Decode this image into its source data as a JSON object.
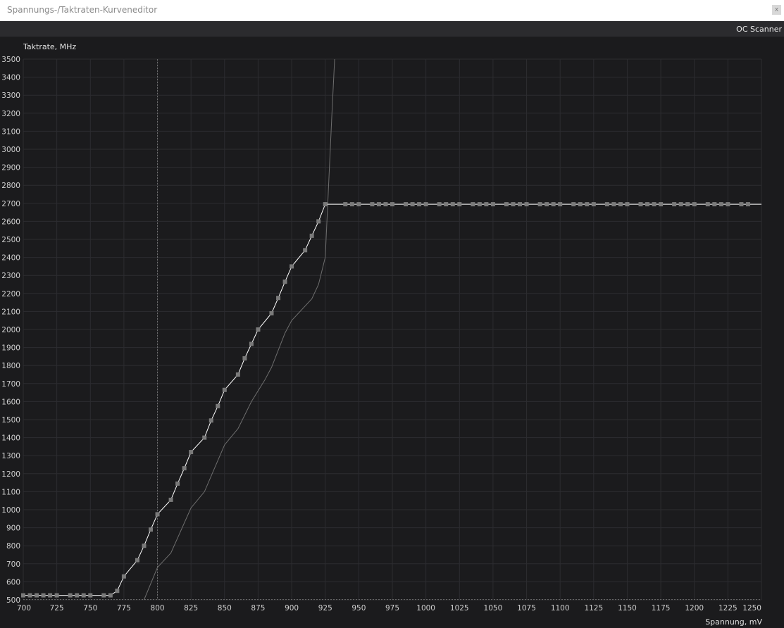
{
  "window": {
    "title": "Spannungs-/Taktraten-Kurveneditor",
    "close_label": "x"
  },
  "toolbar": {
    "oc_scanner_label": "OC Scanner"
  },
  "colors": {
    "background": "#1b1b1d",
    "grid": "#2c2c30",
    "curve": "#ffffff",
    "reference_curve": "#6e6e6e",
    "point": "#7a7a7a"
  },
  "chart_data": {
    "type": "line",
    "xlabel": "Spannung, mV",
    "ylabel": "Taktrate, MHz",
    "xlim": [
      700,
      1250
    ],
    "ylim": [
      500,
      3500
    ],
    "x_ticks": [
      700,
      725,
      750,
      775,
      800,
      825,
      850,
      875,
      900,
      925,
      950,
      975,
      1000,
      1025,
      1050,
      1075,
      1100,
      1125,
      1150,
      1175,
      1200,
      1225,
      1250
    ],
    "y_ticks": [
      500,
      600,
      700,
      800,
      900,
      1000,
      1100,
      1200,
      1300,
      1400,
      1500,
      1600,
      1700,
      1800,
      1900,
      2000,
      2100,
      2200,
      2300,
      2400,
      2500,
      2600,
      2700,
      2800,
      2900,
      3000,
      3100,
      3200,
      3300,
      3400,
      3500
    ],
    "grid": true,
    "current_voltage_marker": 800,
    "series": [
      {
        "x": [
          700,
          705,
          710,
          715,
          720,
          725,
          735,
          740,
          745,
          750,
          760,
          765,
          770,
          775,
          785,
          790,
          795,
          800,
          810,
          815,
          820,
          825,
          835,
          840,
          845,
          850,
          860,
          865,
          870,
          875,
          885,
          890,
          895,
          900,
          910,
          915,
          920,
          925
        ],
        "y": [
          525,
          525,
          525,
          525,
          525,
          525,
          525,
          525,
          525,
          525,
          525,
          525,
          550,
          630,
          720,
          800,
          890,
          975,
          1055,
          1145,
          1230,
          1320,
          1400,
          1495,
          1575,
          1665,
          1750,
          1840,
          1920,
          2000,
          2090,
          2175,
          2265,
          2350,
          2440,
          2520,
          2600,
          2695
        ]
      },
      {
        "x": [
          940,
          945,
          950,
          960,
          965,
          970,
          975,
          985,
          990,
          995,
          1000,
          1010,
          1015,
          1020,
          1025,
          1035,
          1040,
          1045,
          1050,
          1060,
          1065,
          1070,
          1075,
          1085,
          1090,
          1095,
          1100,
          1110,
          1115,
          1120,
          1125,
          1135,
          1140,
          1145,
          1150,
          1160,
          1165,
          1170,
          1175,
          1185,
          1190,
          1195,
          1200,
          1210,
          1215,
          1220,
          1225,
          1235,
          1240
        ],
        "y": [
          2695,
          2695,
          2695,
          2695,
          2695,
          2695,
          2695,
          2695,
          2695,
          2695,
          2695,
          2695,
          2695,
          2695,
          2695,
          2695,
          2695,
          2695,
          2695,
          2695,
          2695,
          2695,
          2695,
          2695,
          2695,
          2695,
          2695,
          2695,
          2695,
          2695,
          2695,
          2695,
          2695,
          2695,
          2695,
          2695,
          2695,
          2695,
          2695,
          2695,
          2695,
          2695,
          2695,
          2695,
          2695,
          2695,
          2695,
          2695,
          2695
        ]
      },
      {
        "x": [
          790,
          800,
          810,
          825,
          835,
          850,
          860,
          870,
          880,
          885,
          895,
          900,
          915,
          920,
          925,
          930,
          932
        ],
        "y": [
          500,
          680,
          760,
          1010,
          1100,
          1360,
          1450,
          1600,
          1720,
          1790,
          1980,
          2050,
          2170,
          2250,
          2400,
          3200,
          3500
        ]
      }
    ]
  }
}
